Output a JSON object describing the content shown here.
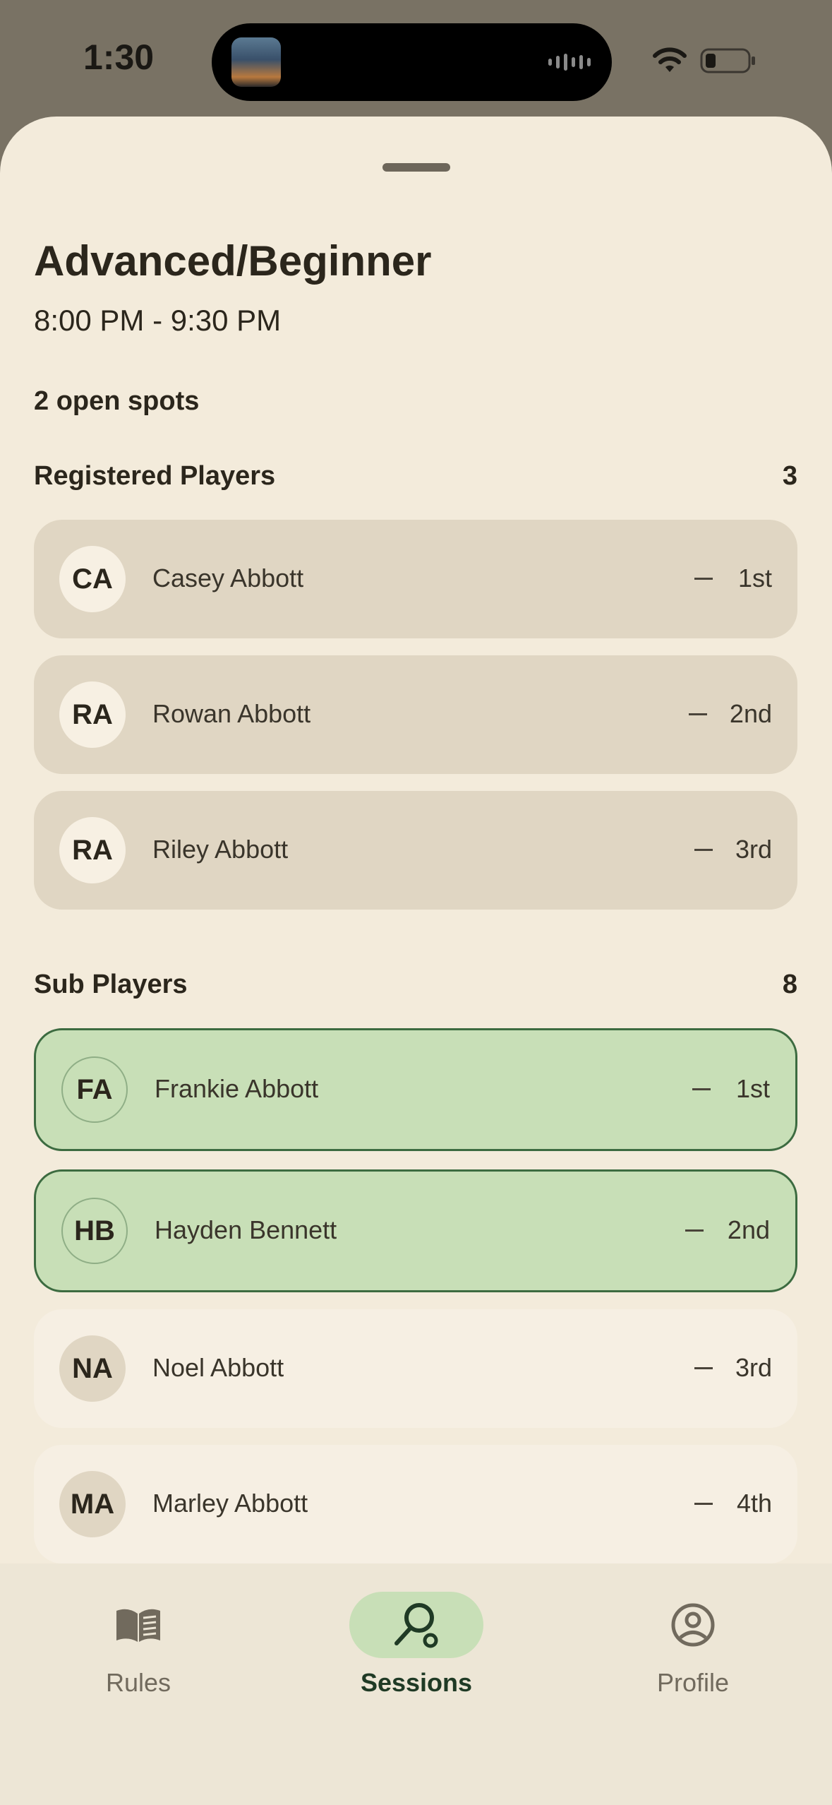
{
  "status": {
    "time": "1:30"
  },
  "session": {
    "title": "Advanced/Beginner",
    "time": "8:00 PM - 9:30 PM",
    "open_spots": "2 open spots"
  },
  "registered": {
    "heading": "Registered Players",
    "count": "3",
    "players": [
      {
        "initials": "CA",
        "name": "Casey Abbott",
        "rank": "1st"
      },
      {
        "initials": "RA",
        "name": "Rowan Abbott",
        "rank": "2nd"
      },
      {
        "initials": "RA",
        "name": "Riley Abbott",
        "rank": "3rd"
      }
    ]
  },
  "subs": {
    "heading": "Sub Players",
    "count": "8",
    "players": [
      {
        "initials": "FA",
        "name": "Frankie Abbott",
        "rank": "1st",
        "highlighted": true
      },
      {
        "initials": "HB",
        "name": "Hayden Bennett",
        "rank": "2nd",
        "highlighted": true
      },
      {
        "initials": "NA",
        "name": "Noel Abbott",
        "rank": "3rd",
        "highlighted": false
      },
      {
        "initials": "MA",
        "name": "Marley Abbott",
        "rank": "4th",
        "highlighted": false
      }
    ]
  },
  "nav": {
    "items": [
      {
        "label": "Rules",
        "icon": "book-icon",
        "active": false
      },
      {
        "label": "Sessions",
        "icon": "racket-icon",
        "active": true
      },
      {
        "label": "Profile",
        "icon": "account-icon",
        "active": false
      }
    ]
  },
  "colors": {
    "sheet_bg": "#f3ebdb",
    "card_bg": "#e0d6c3",
    "highlight_bg": "#c8dfb7",
    "highlight_border": "#3c6b40"
  }
}
